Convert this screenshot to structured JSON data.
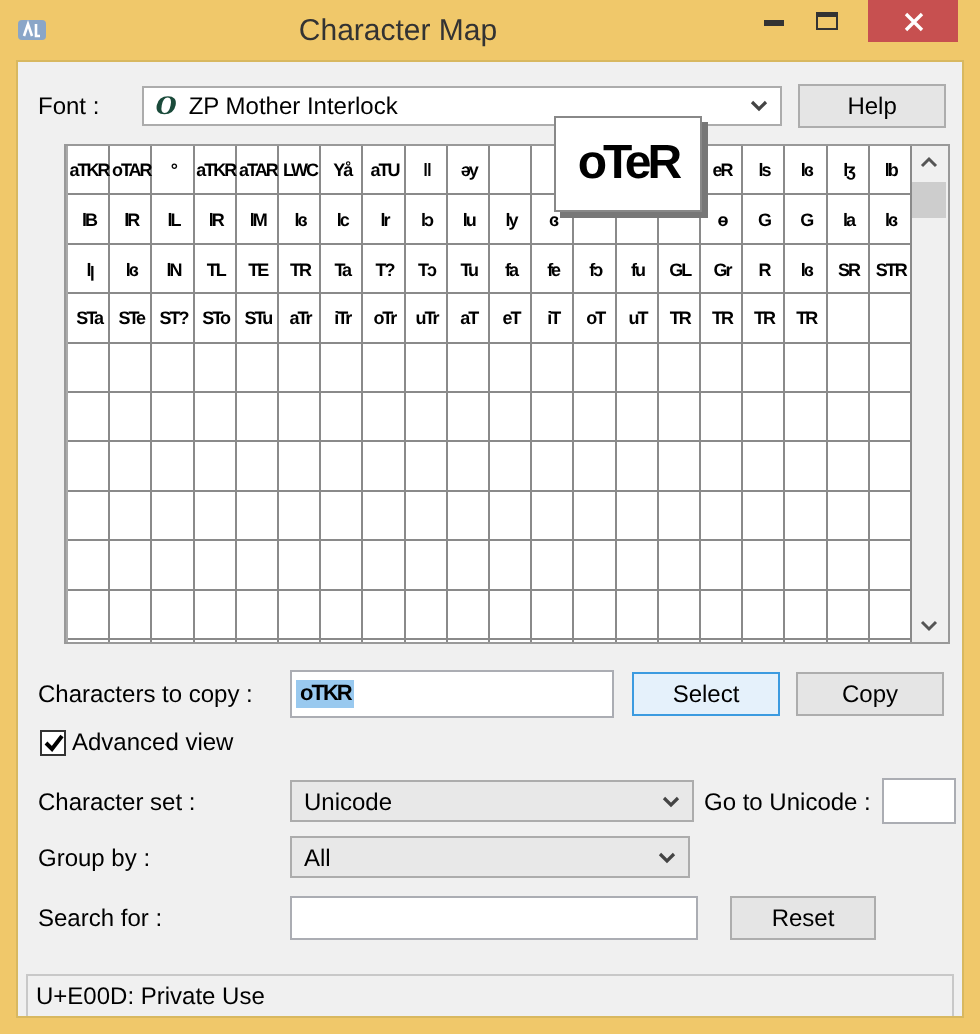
{
  "window": {
    "title": "Character Map"
  },
  "font": {
    "label": "Font :",
    "value": "ZP Mother Interlock",
    "font_icon": "O"
  },
  "help_button": "Help",
  "grid": {
    "rows": [
      [
        "aTKR",
        "oTAR",
        "°",
        "aTKR",
        "aTAR",
        "LWC",
        "Yå",
        "aTU",
        "ǁ",
        "ǝy",
        null,
        null,
        null,
        null,
        null,
        "eR",
        "ls",
        "lɞ",
        "lʒ",
        "lb"
      ],
      [
        "lB",
        "lR",
        "lL",
        "lR",
        "lM",
        "lɞ",
        "lc",
        "lr",
        "lɔ",
        "lu",
        "ly",
        "ɞ",
        null,
        null,
        null,
        "ɵ",
        "G",
        "G",
        "la",
        "lɞ"
      ],
      [
        "lꞁ",
        "lɞ",
        "lN",
        "TL",
        "TE",
        "TR",
        "Ta",
        "T?",
        "Tɔ",
        "Tu",
        "fa",
        "fe",
        "fɔ",
        "fu",
        "GL",
        "Gr",
        "R",
        "lɞ",
        "SR",
        "STR"
      ],
      [
        "STa",
        "STe",
        "ST?",
        "STo",
        "STu",
        "aTr",
        "iTr",
        "oTr",
        "uTr",
        "aT",
        "eT",
        "iT",
        "oT",
        "uT",
        "TR",
        "TR",
        "TR",
        "TR",
        null,
        null
      ],
      [
        null,
        null,
        null,
        null,
        null,
        null,
        null,
        null,
        null,
        null,
        null,
        null,
        null,
        null,
        null,
        null,
        null,
        null,
        null,
        null
      ],
      [
        null,
        null,
        null,
        null,
        null,
        null,
        null,
        null,
        null,
        null,
        null,
        null,
        null,
        null,
        null,
        null,
        null,
        null,
        null,
        null
      ],
      [
        null,
        null,
        null,
        null,
        null,
        null,
        null,
        null,
        null,
        null,
        null,
        null,
        null,
        null,
        null,
        null,
        null,
        null,
        null,
        null
      ],
      [
        null,
        null,
        null,
        null,
        null,
        null,
        null,
        null,
        null,
        null,
        null,
        null,
        null,
        null,
        null,
        null,
        null,
        null,
        null,
        null
      ],
      [
        null,
        null,
        null,
        null,
        null,
        null,
        null,
        null,
        null,
        null,
        null,
        null,
        null,
        null,
        null,
        null,
        null,
        null,
        null,
        null
      ],
      [
        null,
        null,
        null,
        null,
        null,
        null,
        null,
        null,
        null,
        null,
        null,
        null,
        null,
        null,
        null,
        null,
        null,
        null,
        null,
        null
      ]
    ],
    "magnified": "oTeR"
  },
  "copy": {
    "label": "Characters to copy :",
    "value": "oTKR",
    "select_button": "Select",
    "copy_button": "Copy"
  },
  "advanced_view": {
    "label": "Advanced view",
    "checked": true
  },
  "character_set": {
    "label": "Character set :",
    "value": "Unicode"
  },
  "goto_unicode": {
    "label": "Go to Unicode :"
  },
  "group_by": {
    "label": "Group by :",
    "value": "All"
  },
  "search": {
    "label": "Search for :",
    "reset_button": "Reset"
  },
  "status_bar": "U+E00D: Private Use"
}
